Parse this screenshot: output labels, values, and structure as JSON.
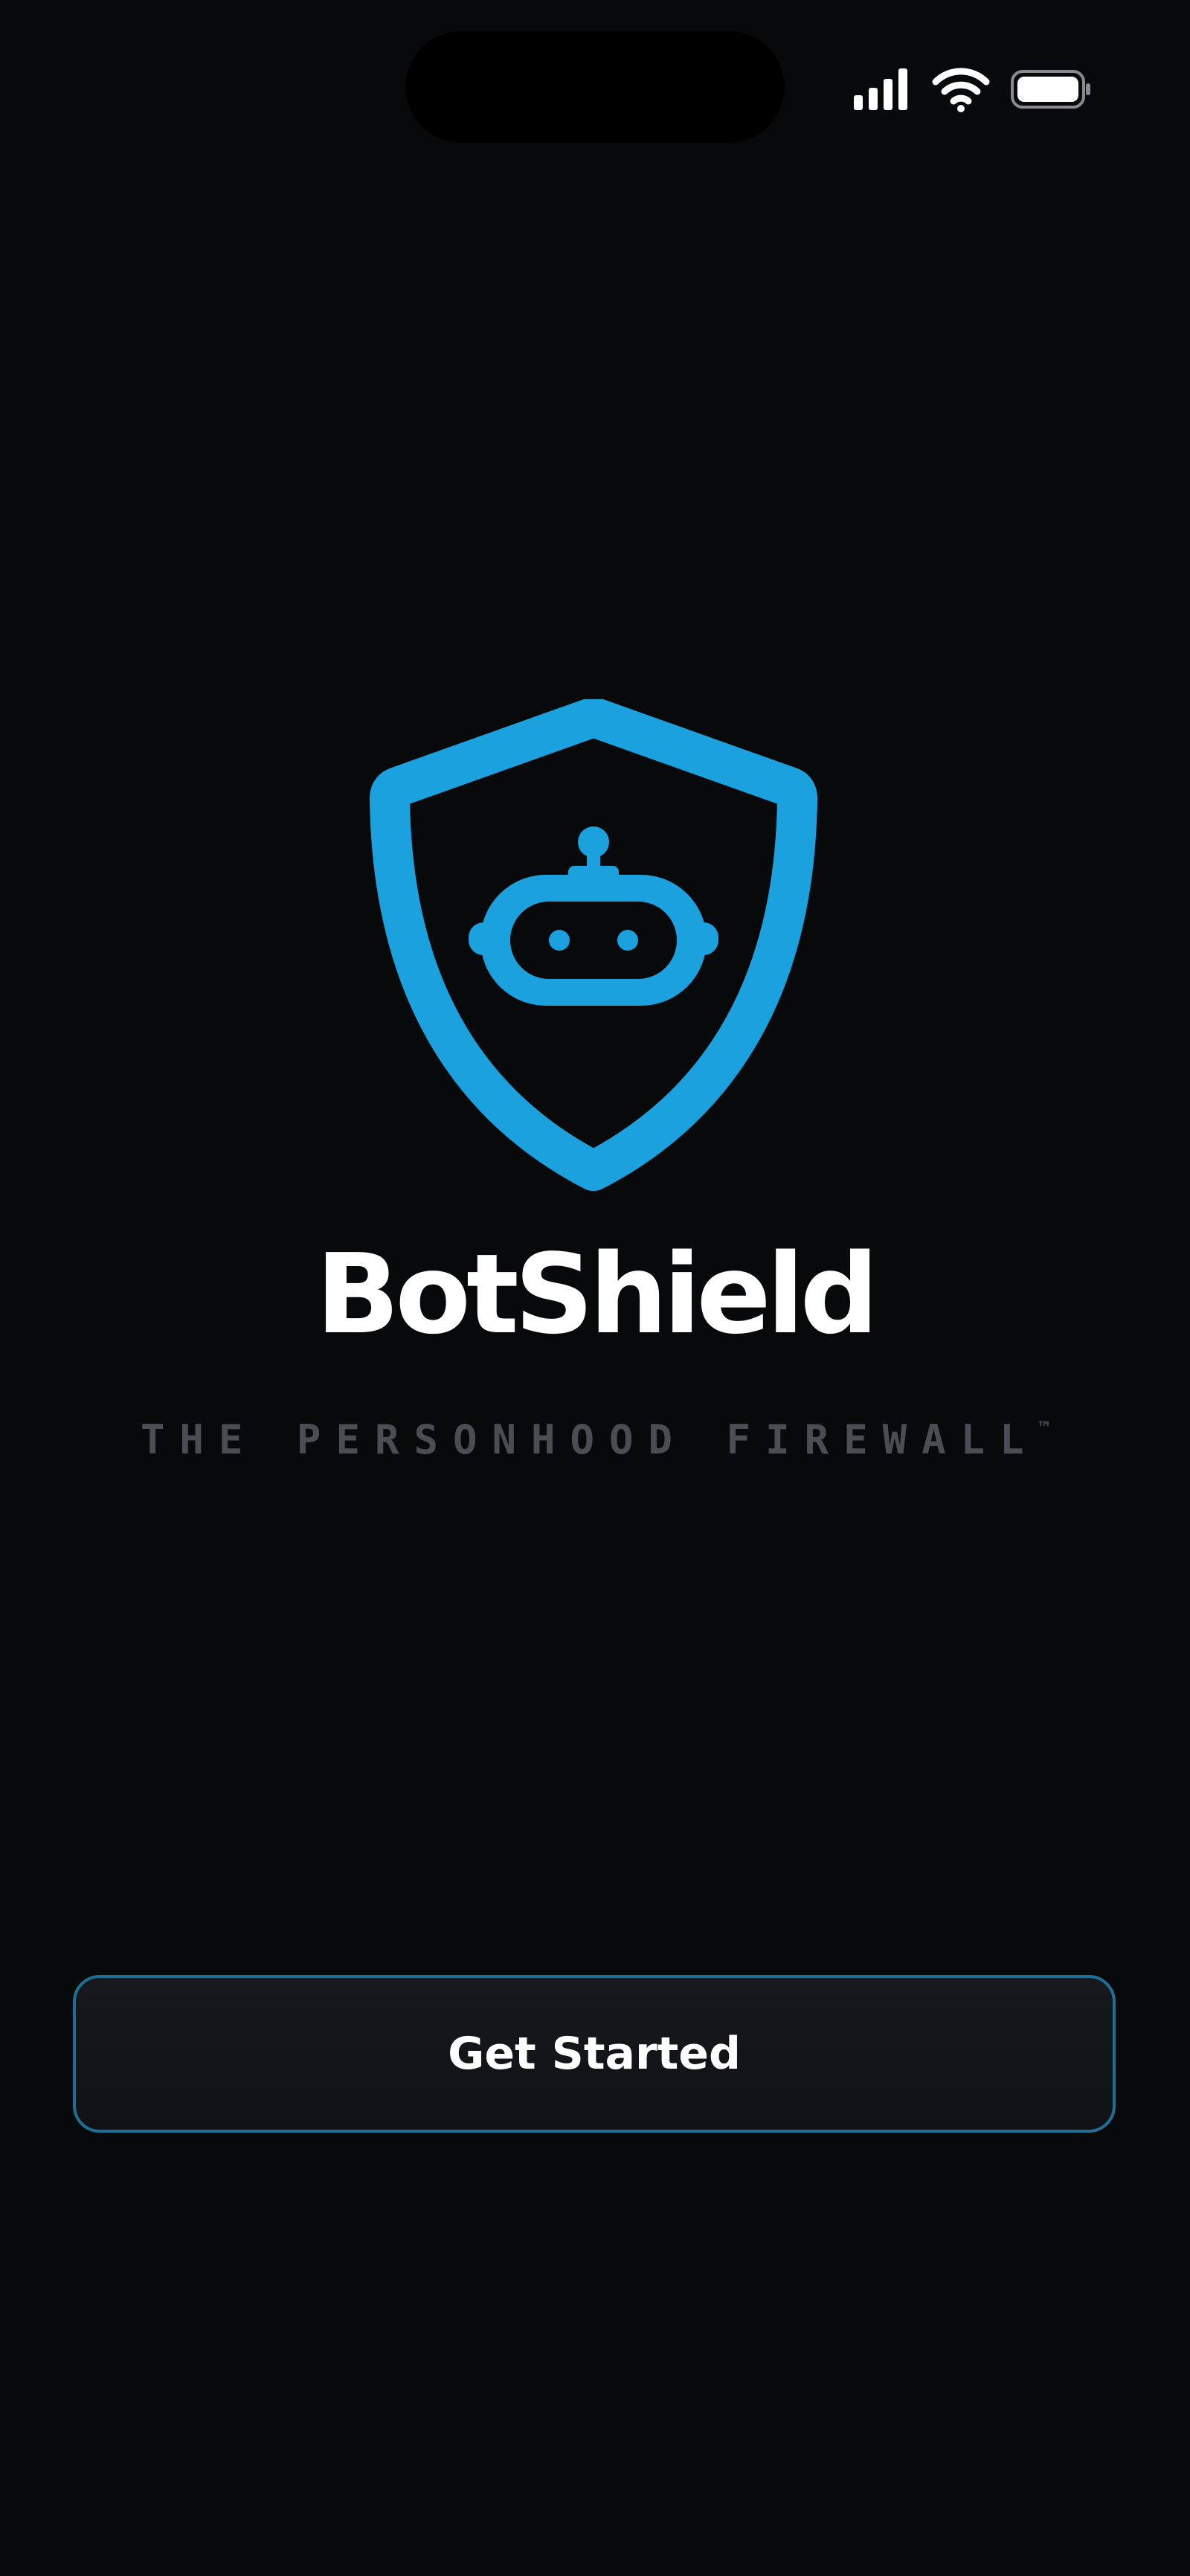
{
  "app": {
    "brand_name": "BotShield",
    "tagline": "THE PERSONHOOD FIREWALL",
    "trademark": "™"
  },
  "actions": {
    "get_started_label": "Get Started"
  },
  "status_bar": {
    "icons": [
      "cellular-signal-icon",
      "wifi-icon",
      "battery-icon"
    ]
  },
  "colors": {
    "background": "#08090b",
    "accent": "#1ba1de",
    "button_border": "#1d6f96",
    "tagline": "#4b4d52",
    "text": "#ffffff"
  }
}
